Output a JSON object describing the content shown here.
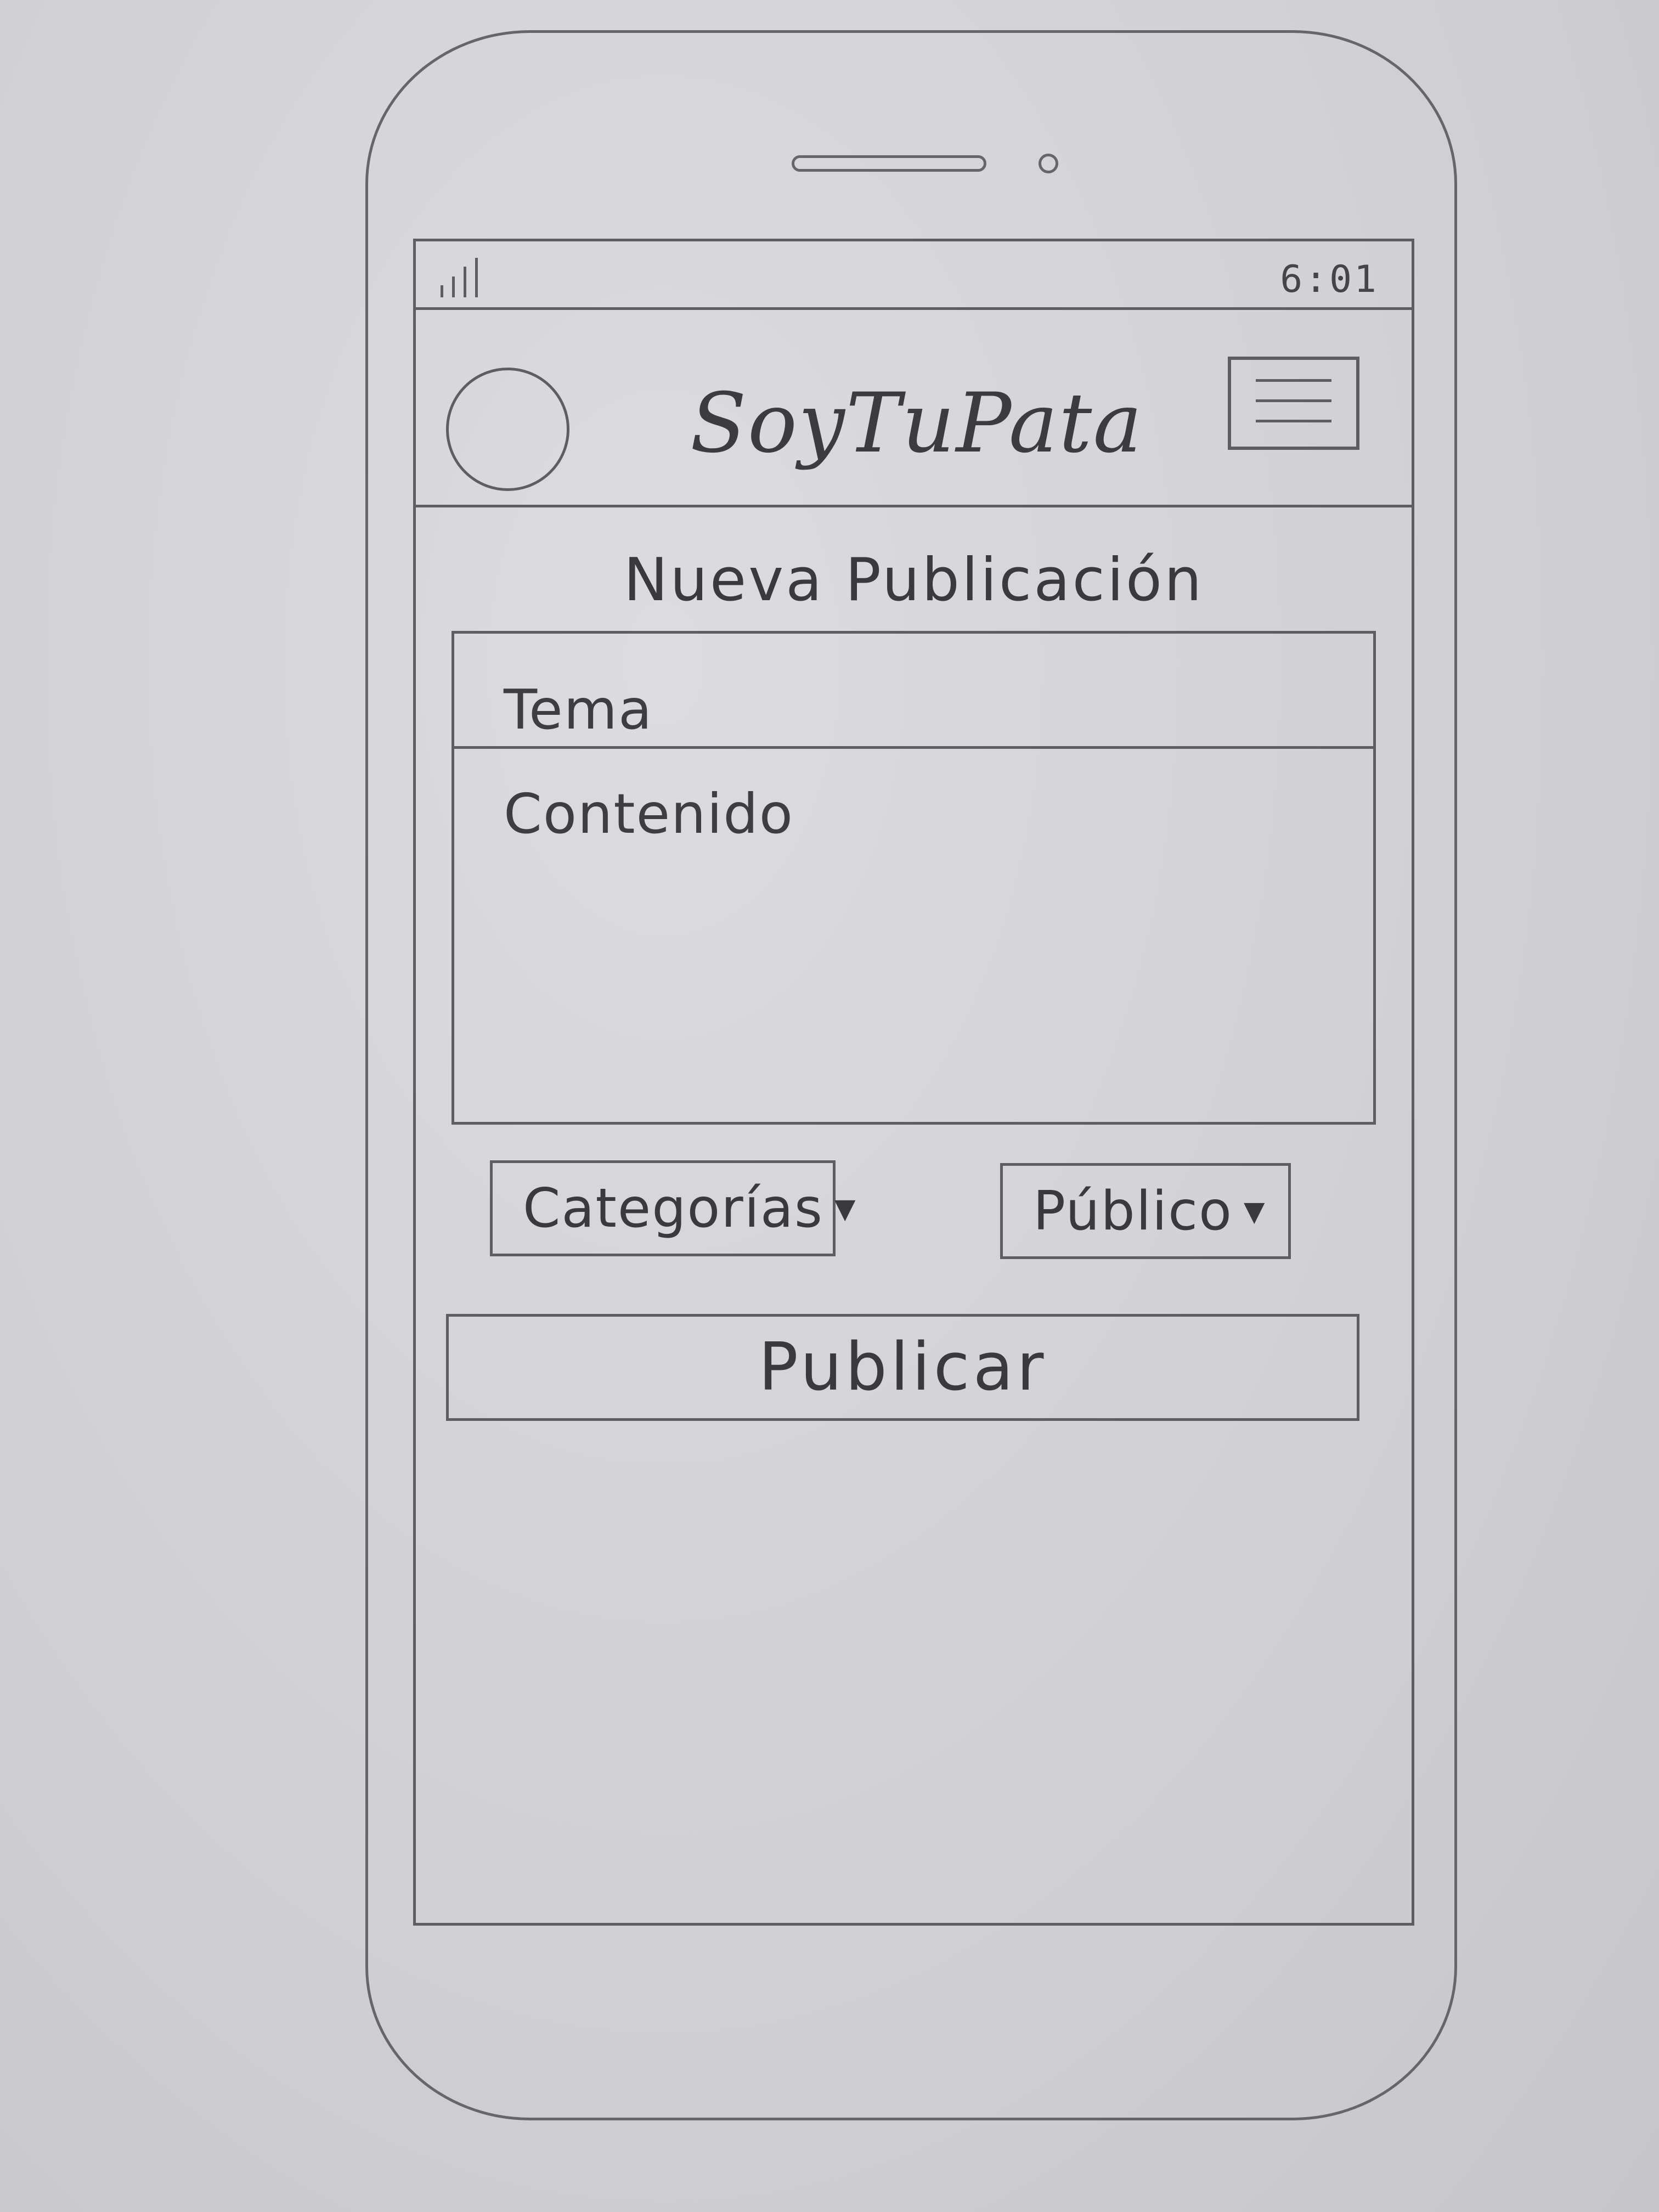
{
  "status_bar": {
    "time": "6:01",
    "signal_icon": "signal-bars-icon"
  },
  "header": {
    "avatar_icon": "avatar-circle",
    "app_title": "SoyTuPata",
    "menu_icon": "hamburger-menu-icon"
  },
  "form": {
    "title": "Nueva Publicación",
    "topic_placeholder": "Tema",
    "content_placeholder": "Contenido",
    "category_dropdown": {
      "label": "Categorías",
      "caret_icon": "caret-down-icon"
    },
    "audience_dropdown": {
      "label": "Público",
      "caret_icon": "caret-down-icon"
    },
    "publish_label": "Publicar"
  }
}
